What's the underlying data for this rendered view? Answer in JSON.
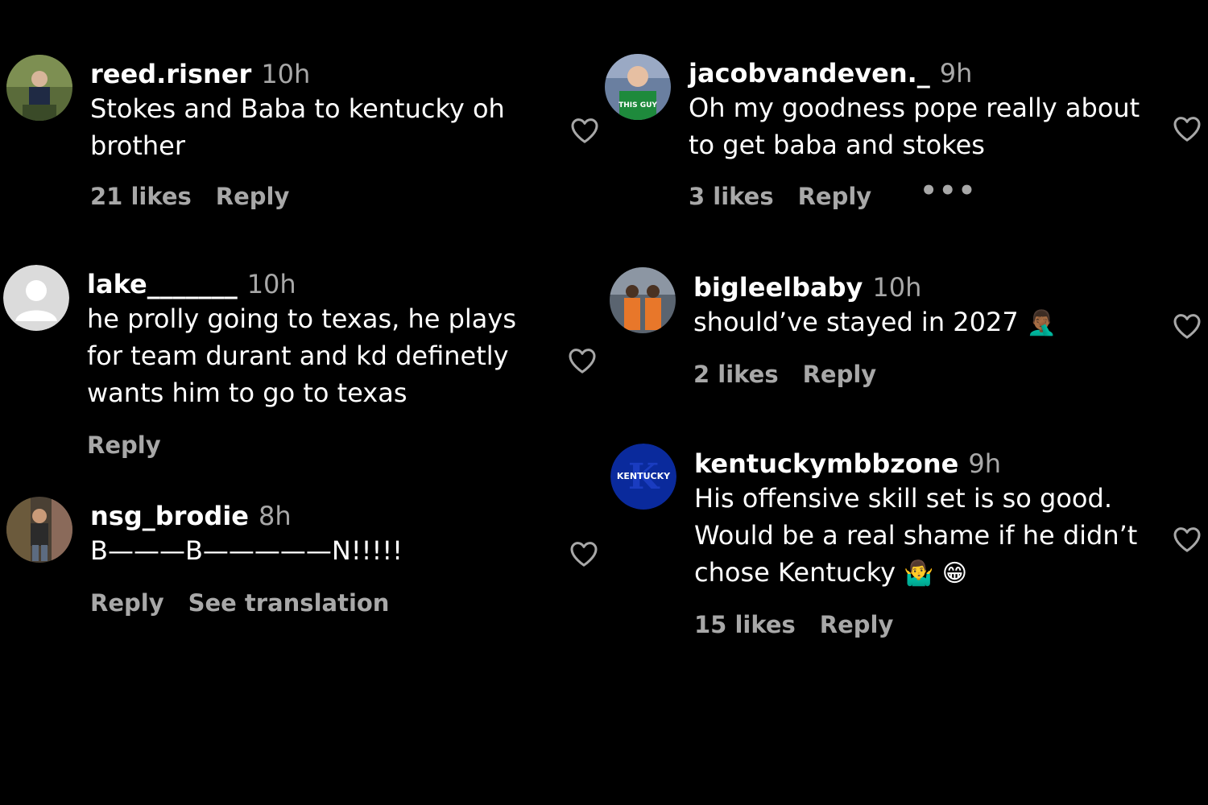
{
  "colors": {
    "background": "#000000",
    "text": "#ffffff",
    "muted": "#a8a8a8"
  },
  "comments": [
    {
      "username": "reed.risner",
      "time": "10h",
      "lines": [
        "Stokes and Baba to kentucky oh",
        "brother"
      ],
      "likes": "21 likes",
      "reply": "Reply"
    },
    {
      "username": "lake_______",
      "time": "10h",
      "lines": [
        "he prolly going to texas, he plays",
        "for team durant and kd definetly",
        "wants him to go to texas"
      ],
      "reply": "Reply"
    },
    {
      "username": "nsg_brodie",
      "time": "8h",
      "lines": [
        "B———B—————N!!!!!"
      ],
      "reply": "Reply",
      "see_translation": "See translation"
    },
    {
      "username": "jacobvandeven._",
      "time": "9h",
      "lines": [
        "Oh my goodness pope really about",
        "to get baba and stokes"
      ],
      "likes": "3 likes",
      "reply": "Reply",
      "more": "•••"
    },
    {
      "username": "bigleelbaby",
      "time": "10h",
      "lines": [
        "should’ve stayed in 2027"
      ],
      "emoji": [
        "🤦🏾‍♂️"
      ],
      "likes": "2 likes",
      "reply": "Reply"
    },
    {
      "username": "kentuckymbbzone",
      "time": "9h",
      "lines": [
        "His offensive skill set is so good.",
        "Would be a real shame if he didn’t",
        "chose Kentucky"
      ],
      "emoji": [
        "🤷‍♂️",
        "😁"
      ],
      "likes": "15 likes",
      "reply": "Reply",
      "avatar_text": "KENTUCKY"
    }
  ],
  "icons": {
    "heart": "heart-outline-icon",
    "more": "more-options-icon"
  }
}
